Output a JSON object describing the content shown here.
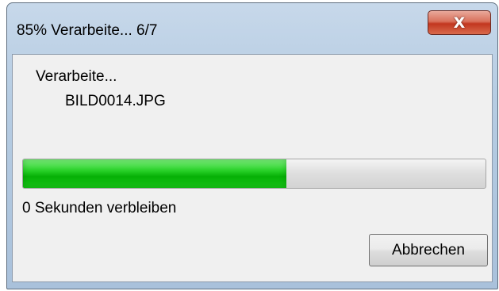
{
  "window": {
    "title": "85% Verarbeite... 6/7",
    "close_icon": "close-x-icon"
  },
  "dialog": {
    "status_label": "Verarbeite...",
    "file_name": "BILD0014.JPG",
    "progress_fraction": 0.57,
    "progress_color": "#06b006",
    "time_remaining": "0 Sekunden verbleiben",
    "cancel_label": "Abbrechen"
  }
}
